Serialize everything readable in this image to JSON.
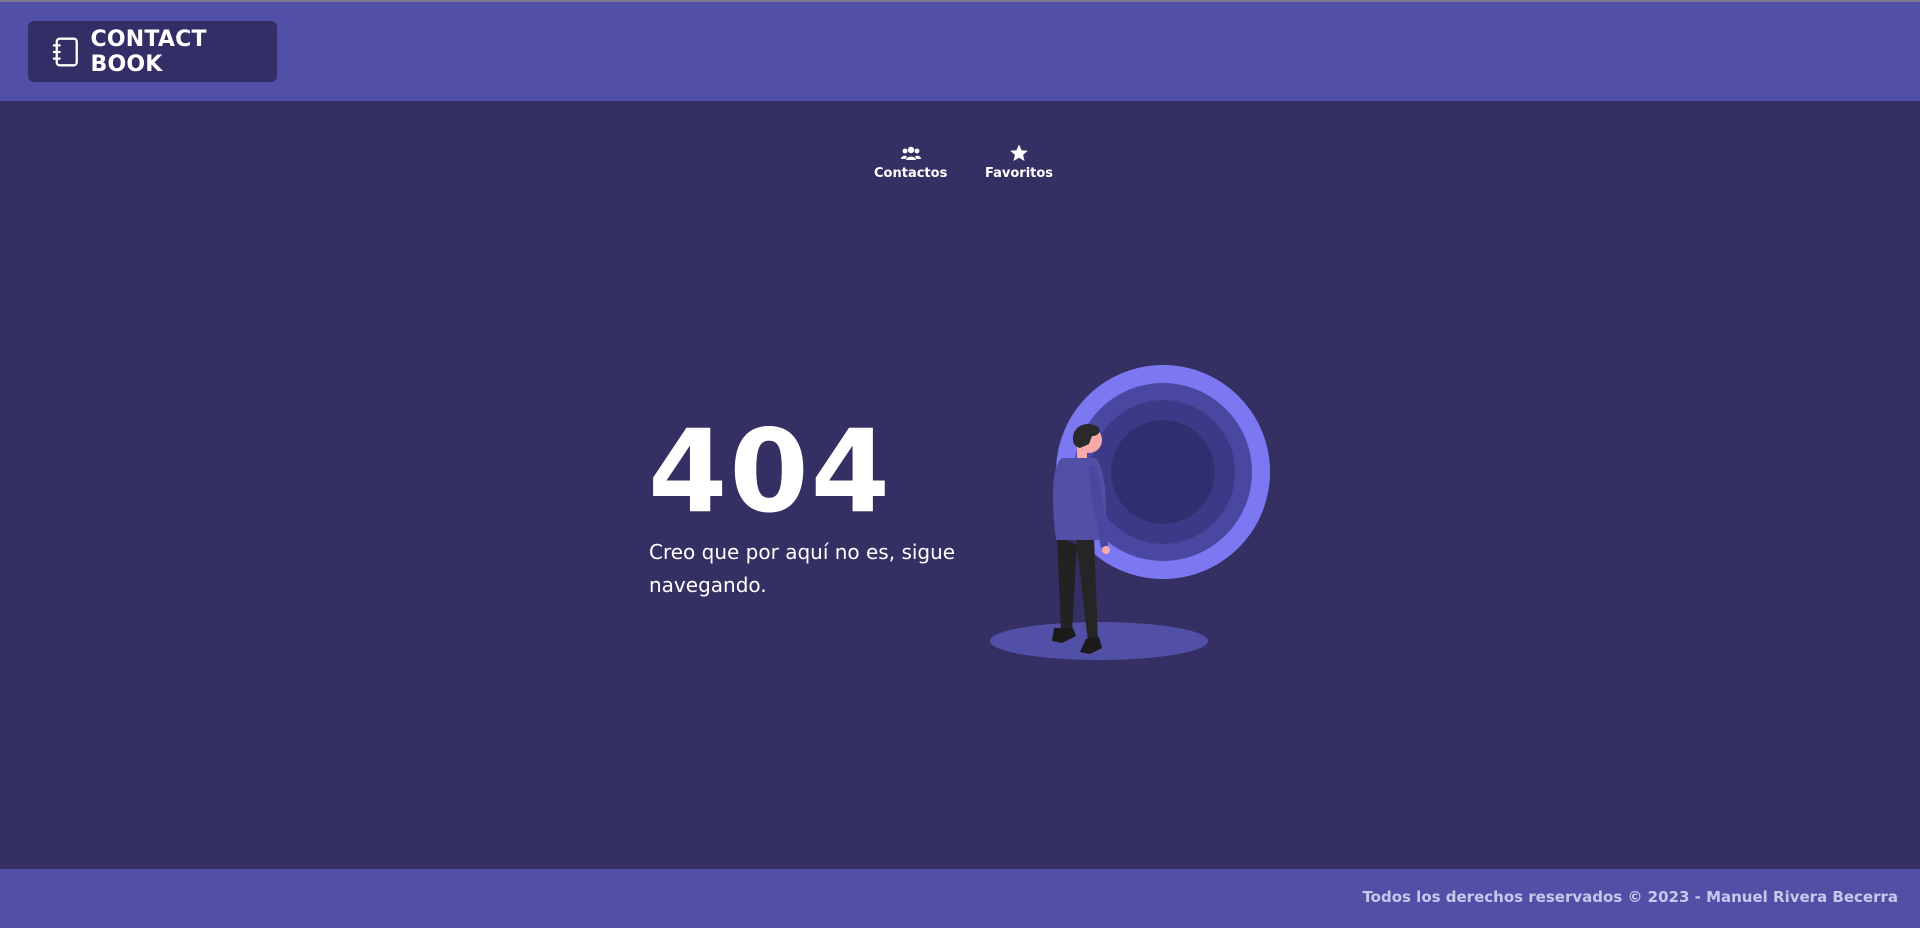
{
  "header": {
    "brand_label": "CONTACT BOOK",
    "brand_icon": "address-book-icon"
  },
  "nav": {
    "items": [
      {
        "label": "Contactos",
        "icon": "users-icon"
      },
      {
        "label": "Favoritos",
        "icon": "star-icon"
      }
    ]
  },
  "error": {
    "code": "404",
    "message": "Creo que por aquí no es, sigue navegando."
  },
  "footer": {
    "text": "Todos los derechos reservados © 2023 - Manuel Rivera Becerra"
  },
  "colors": {
    "header_bg": "#5250a6",
    "page_bg": "#343063",
    "brand_bg": "#332f66",
    "accent": "#7b78f2"
  }
}
